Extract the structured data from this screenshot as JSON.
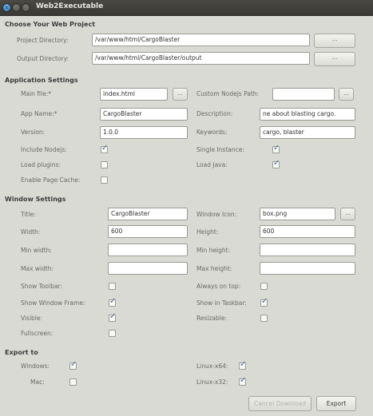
{
  "window": {
    "title": "Web2Executable"
  },
  "project": {
    "section": "Choose Your Web Project",
    "project_dir_label": "Project Directory:",
    "project_dir_value": "/var/www/html/CargoBlaster",
    "output_dir_label": "Output Directory:",
    "output_dir_value": "/var/www/html/CargoBlaster/output",
    "browse_label": "..."
  },
  "app": {
    "section": "Application Settings",
    "main_file_label": "Main file:*",
    "main_file_value": "index.html",
    "custom_nodejs_label": "Custom Nodejs Path:",
    "custom_nodejs_value": "",
    "app_name_label": "App Name:*",
    "app_name_value": "CargoBlaster",
    "description_label": "Description:",
    "description_value": "ne about blasting cargo.",
    "version_label": "Version:",
    "version_value": "1.0.0",
    "keywords_label": "Keywords:",
    "keywords_value": "cargo, blaster",
    "include_nodejs_label": "Include Nodejs:",
    "include_nodejs_checked": true,
    "single_instance_label": "Single Instance:",
    "single_instance_checked": true,
    "load_plugins_label": "Load plugins:",
    "load_plugins_checked": false,
    "load_java_label": "Load Java:",
    "load_java_checked": true,
    "enable_cache_label": "Enable Page Cache:",
    "enable_cache_checked": false,
    "browse_label": "..."
  },
  "window_settings": {
    "section": "Window Settings",
    "title_label": "Title:",
    "title_value": "CargoBlaster",
    "icon_label": "Window Icon:",
    "icon_value": "box.png",
    "width_label": "Width:",
    "width_value": "600",
    "height_label": "Height:",
    "height_value": "600",
    "min_width_label": "Min width:",
    "min_width_value": "",
    "min_height_label": "Min height:",
    "min_height_value": "",
    "max_width_label": "Max width:",
    "max_width_value": "",
    "max_height_label": "Max height:",
    "max_height_value": "",
    "show_toolbar_label": "Show Toolbar:",
    "show_toolbar_checked": false,
    "always_on_top_label": "Always on top:",
    "always_on_top_checked": false,
    "show_frame_label": "Show Window Frame:",
    "show_frame_checked": true,
    "show_taskbar_label": "Show in Taskbar:",
    "show_taskbar_checked": true,
    "visible_label": "Visible:",
    "visible_checked": true,
    "resizable_label": "Resizable:",
    "resizable_checked": false,
    "fullscreen_label": "Fullscreen:",
    "fullscreen_checked": false,
    "browse_label": "..."
  },
  "export": {
    "section": "Export to",
    "windows_label": "Windows:",
    "windows_checked": true,
    "linux64_label": "Linux-x64:",
    "linux64_checked": true,
    "mac_label": "Mac:",
    "mac_checked": false,
    "linux32_label": "Linux-x32:",
    "linux32_checked": true,
    "cancel_label": "Cancel Download",
    "export_label": "Export"
  }
}
